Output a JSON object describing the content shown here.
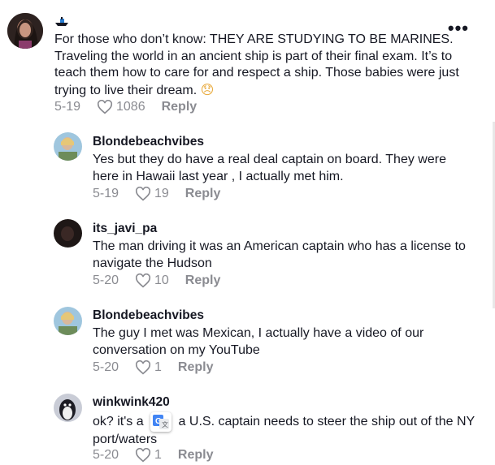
{
  "comments": [
    {
      "username": "",
      "text": "For those who don’t know: THEY ARE STUDYING TO BE MARINES. Traveling the world in an ancient ship is part of their final exam. It’s to teach them how to care for and respect a ship. Those babies were just trying to live their dream.",
      "emoji": "😞",
      "date": "5-19",
      "likes": "1086",
      "reply": "Reply"
    }
  ],
  "replies": [
    {
      "username": "Blondebeachvibes",
      "text": "Yes but they do have a real deal captain on board. They were here in Hawaii last year , I actually met him.",
      "date": "5-19",
      "likes": "19",
      "reply": "Reply"
    },
    {
      "username": "its_javi_pa",
      "text": "The man driving it was an American captain who has a license to navigate the Hudson",
      "date": "5-20",
      "likes": "10",
      "reply": "Reply"
    },
    {
      "username": "Blondebeachvibes",
      "text": "The guy I met was Mexican, I actually have a video of our conversation on my YouTube",
      "date": "5-20",
      "likes": "1",
      "reply": "Reply"
    },
    {
      "username": "winkwink420",
      "text_before": "ok? it's a",
      "text_after": "a U.S. captain needs to steer the ship out of the NY port/waters",
      "date": "5-20",
      "likes": "1",
      "reply": "Reply"
    }
  ],
  "icons": {
    "more": "more-options-icon",
    "like": "heart-icon",
    "username_badge": "boat-icon",
    "translate": "translate-icon"
  },
  "colors": {
    "text": "#161823",
    "muted": "#8a8b91"
  }
}
